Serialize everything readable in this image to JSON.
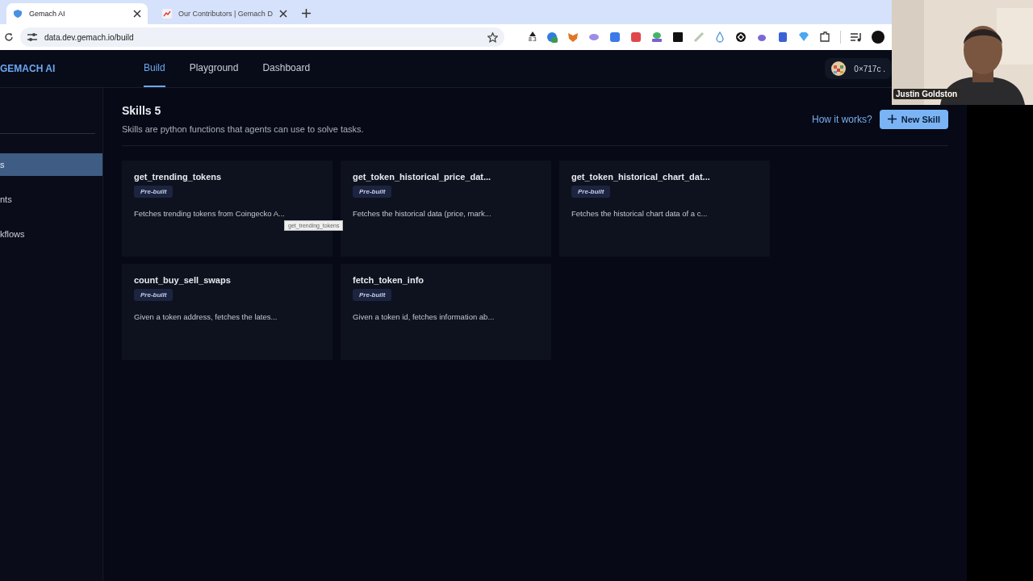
{
  "browser": {
    "tabs": [
      {
        "title": "Gemach AI",
        "selected": true
      },
      {
        "title": "Our Contributors | Gemach D",
        "selected": false
      }
    ],
    "address": "data.dev.gemach.io/build",
    "extension_badge": "8.3"
  },
  "app": {
    "logo": "GEMACH AI",
    "nav": [
      {
        "label": "Build",
        "selected": true
      },
      {
        "label": "Playground",
        "selected": false
      },
      {
        "label": "Dashboard",
        "selected": false
      }
    ],
    "wallet": "0×717c ."
  },
  "sidebar": {
    "items": [
      {
        "label": "s",
        "selected": true
      },
      {
        "label": "nts",
        "selected": false
      },
      {
        "label": "kflows",
        "selected": false
      }
    ]
  },
  "header": {
    "title": "Skills 5",
    "subtitle": "Skills are python functions that agents can use to solve tasks.",
    "help_link": "How it works?",
    "new_button": "New Skill"
  },
  "skills": [
    {
      "name": "get_trending_tokens",
      "badge": "Pre-built",
      "description": "Fetches trending tokens from Coingecko A..."
    },
    {
      "name": "get_token_historical_price_dat...",
      "badge": "Pre-built",
      "description": "Fetches the historical data (price, mark..."
    },
    {
      "name": "get_token_historical_chart_dat...",
      "badge": "Pre-built",
      "description": "Fetches the historical chart data of a c..."
    },
    {
      "name": "count_buy_sell_swaps",
      "badge": "Pre-built",
      "description": "Given a token address, fetches the lates..."
    },
    {
      "name": "fetch_token_info",
      "badge": "Pre-built",
      "description": "Given a token id, fetches information ab..."
    }
  ],
  "tooltip": "get_trending_tokens",
  "video": {
    "kind": "picture",
    "caption": "Justin Goldston"
  }
}
